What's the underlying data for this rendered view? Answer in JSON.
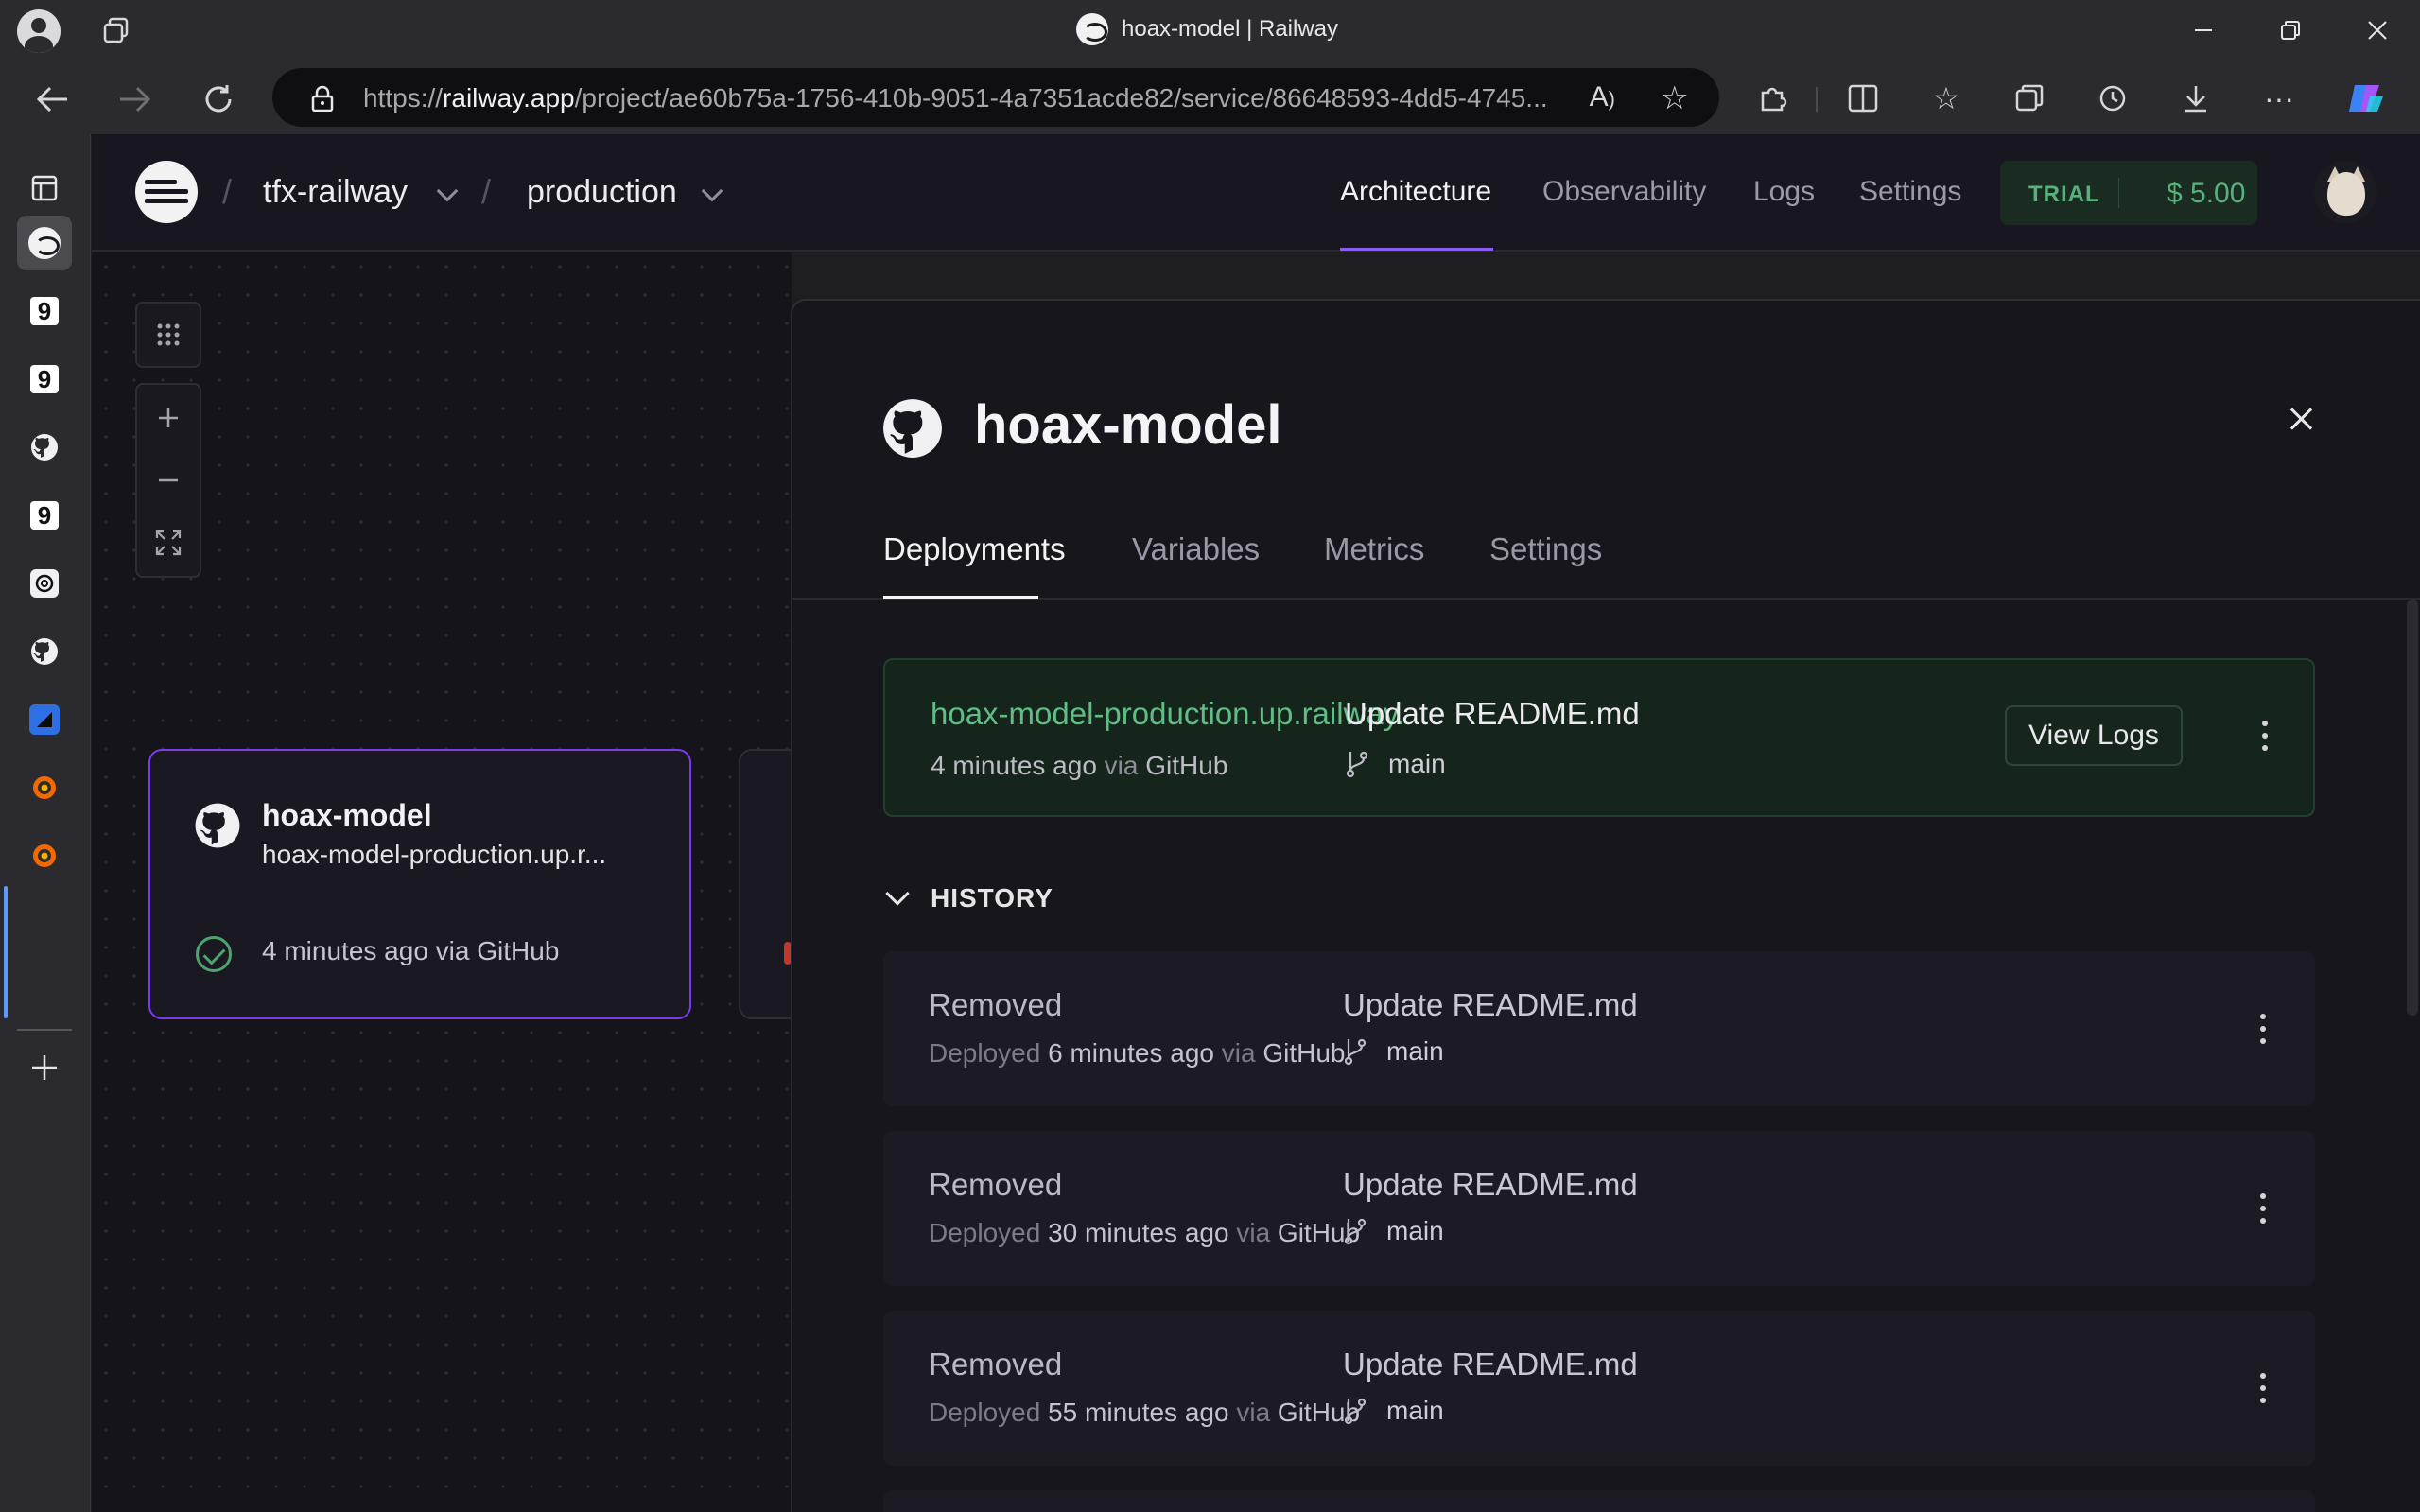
{
  "browser": {
    "window_title": "hoax-model | Railway",
    "url_prefix": "https://",
    "url_domain": "railway.app",
    "url_path": "/project/ae60b75a-1756-410b-9051-4a7351acde82/service/86648593-4dd5-4745..."
  },
  "side_tabs": [
    "railway",
    "9",
    "9",
    "github",
    "9",
    "openai",
    "github",
    "app",
    "grafana",
    "grafana"
  ],
  "app": {
    "project": "tfx-railway",
    "environment": "production",
    "nav": [
      "Architecture",
      "Observability",
      "Logs",
      "Settings"
    ],
    "plan": "TRIAL",
    "credit": "$ 5.00"
  },
  "canvas": {
    "service_card": {
      "name": "hoax-model",
      "url": "hoax-model-production.up.r...",
      "status": "4 minutes ago via GitHub"
    }
  },
  "panel": {
    "title": "hoax-model",
    "tabs": [
      "Deployments",
      "Variables",
      "Metrics",
      "Settings"
    ],
    "active_deployment": {
      "url": "hoax-model-production.up.railway.",
      "time": "4 minutes ago",
      "via": "via",
      "source": "GitHub",
      "commit": "Update README.md",
      "branch": "main",
      "view_logs": "View Logs"
    },
    "history_label": "HISTORY",
    "history": [
      {
        "state": "Removed",
        "deployed": "Deployed",
        "time": "6 minutes ago",
        "via": "via",
        "source": "GitHub",
        "commit": "Update README.md",
        "branch": "main"
      },
      {
        "state": "Removed",
        "deployed": "Deployed",
        "time": "30 minutes ago",
        "via": "via",
        "source": "GitHub",
        "commit": "Update README.md",
        "branch": "main"
      },
      {
        "state": "Removed",
        "deployed": "Deployed",
        "time": "55 minutes ago",
        "via": "via",
        "source": "GitHub",
        "commit": "Update README.md",
        "branch": "main"
      }
    ]
  },
  "colors": {
    "accent_purple": "#8b5cf6",
    "success_green": "#5fbd85",
    "panel_bg": "#17161d"
  }
}
